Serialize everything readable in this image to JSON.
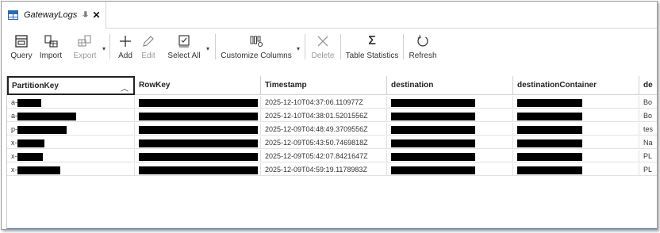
{
  "tab": {
    "title": "GatewayLogs",
    "pin_glyph": "⥥",
    "close_glyph": "✕"
  },
  "toolbar": {
    "buttons": [
      {
        "label": "Query",
        "icon": "query-icon",
        "disabled": false,
        "caret": false
      },
      {
        "label": "Import",
        "icon": "import-icon",
        "disabled": false,
        "caret": false
      },
      {
        "label": "Export",
        "icon": "export-icon",
        "disabled": true,
        "caret": true
      },
      {
        "label": "Add",
        "icon": "add-icon",
        "disabled": false,
        "caret": false
      },
      {
        "label": "Edit",
        "icon": "edit-icon",
        "disabled": true,
        "caret": false
      },
      {
        "label": "Select All",
        "icon": "select-all-icon",
        "disabled": false,
        "caret": true
      },
      {
        "label": "Customize Columns",
        "icon": "customize-columns-icon",
        "disabled": false,
        "caret": true
      },
      {
        "label": "Delete",
        "icon": "delete-icon",
        "disabled": true,
        "caret": false
      },
      {
        "label": "Table Statistics",
        "icon": "sigma-icon",
        "disabled": false,
        "caret": false
      },
      {
        "label": "Refresh",
        "icon": "refresh-icon",
        "disabled": false,
        "caret": false
      }
    ]
  },
  "grid": {
    "columns": [
      "PartitionKey",
      "RowKey",
      "Timestamp",
      "destination",
      "destinationContainer",
      "de"
    ],
    "sorted_glyph": "︿",
    "rows": [
      {
        "partition_prefix": "a-",
        "timestamp": "2025-12-10T04:37:06.110977Z",
        "last": "Bo"
      },
      {
        "partition_prefix": "a-",
        "timestamp": "2025-12-10T04:38:01.5201556Z",
        "last": "Bo"
      },
      {
        "partition_prefix": "p-",
        "timestamp": "2025-12-09T04:48:49.3709556Z",
        "last": "tes"
      },
      {
        "partition_prefix": "x-",
        "timestamp": "2025-12-09T05:43:50.7469818Z",
        "last": "Na"
      },
      {
        "partition_prefix": "x-",
        "timestamp": "2025-12-09T05:42:07.8421647Z",
        "last": "PL"
      },
      {
        "partition_prefix": "x-",
        "timestamp": "2025-12-09T04:59:19.1178983Z",
        "last": "PL"
      }
    ]
  },
  "colors": {
    "redaction": "#000000",
    "selection_border": "#222222",
    "accent": "#2b6cb0"
  }
}
